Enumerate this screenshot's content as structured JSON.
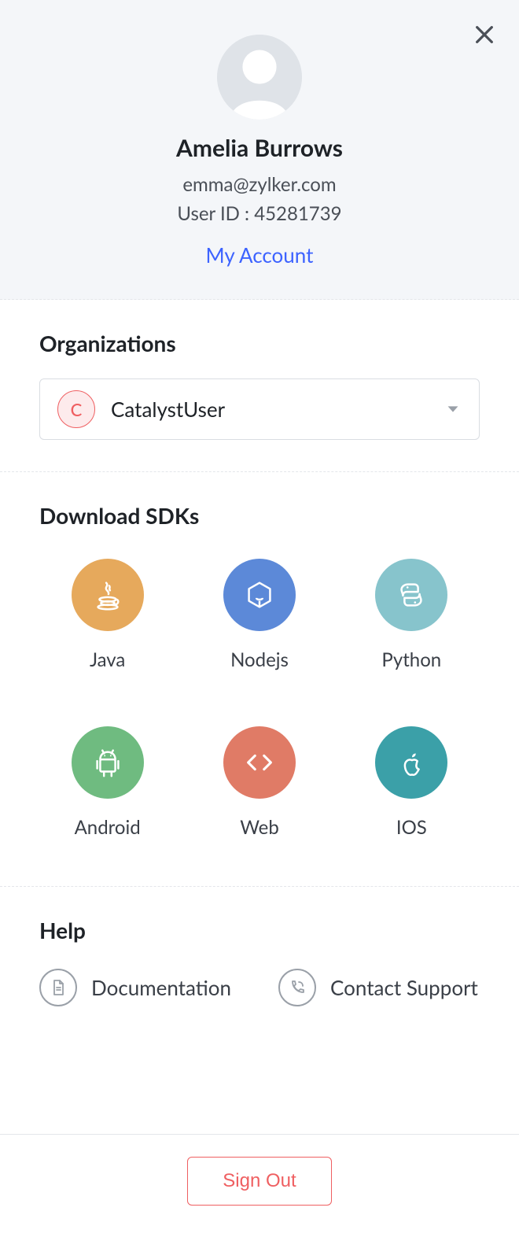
{
  "user": {
    "name": "Amelia Burrows",
    "email": "emma@zylker.com",
    "user_id_label": "User ID : 45281739",
    "my_account_label": "My Account"
  },
  "organizations": {
    "title": "Organizations",
    "selected": {
      "badge_letter": "C",
      "name": "CatalystUser"
    }
  },
  "sdks": {
    "title": "Download SDKs",
    "items": [
      {
        "key": "java",
        "label": "Java",
        "color": "#e6a95c"
      },
      {
        "key": "nodejs",
        "label": "Nodejs",
        "color": "#5c89d8"
      },
      {
        "key": "python",
        "label": "Python",
        "color": "#87c4cc"
      },
      {
        "key": "android",
        "label": "Android",
        "color": "#6fbb80"
      },
      {
        "key": "web",
        "label": "Web",
        "color": "#e07b66"
      },
      {
        "key": "ios",
        "label": "IOS",
        "color": "#3ba0a8"
      }
    ]
  },
  "help": {
    "title": "Help",
    "items": [
      {
        "key": "documentation",
        "label": "Documentation"
      },
      {
        "key": "contact-support",
        "label": "Contact Support"
      }
    ]
  },
  "footer": {
    "sign_out_label": "Sign Out"
  }
}
